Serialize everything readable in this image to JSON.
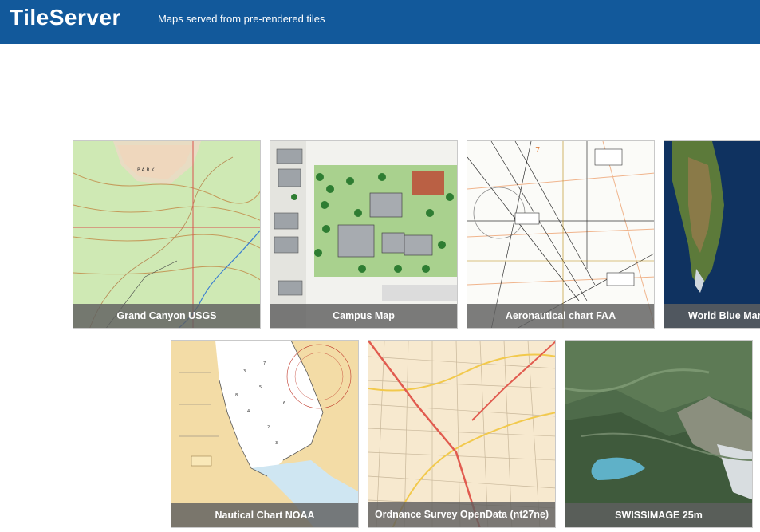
{
  "header": {
    "brand": "TileServer",
    "tagline": "Maps served from pre-rendered tiles"
  },
  "tiles": [
    {
      "title": "Grand Canyon USGS"
    },
    {
      "title": "Campus Map"
    },
    {
      "title": "Aeronautical chart FAA"
    },
    {
      "title": "World Blue Marble"
    },
    {
      "title": "Nautical Chart NOAA"
    },
    {
      "title": "Ordnance Survey OpenData (nt27ne)"
    },
    {
      "title": "SWISSIMAGE 25m"
    }
  ],
  "colors": {
    "header_bg": "#12599b",
    "caption_bg": "#5f5f5f"
  }
}
